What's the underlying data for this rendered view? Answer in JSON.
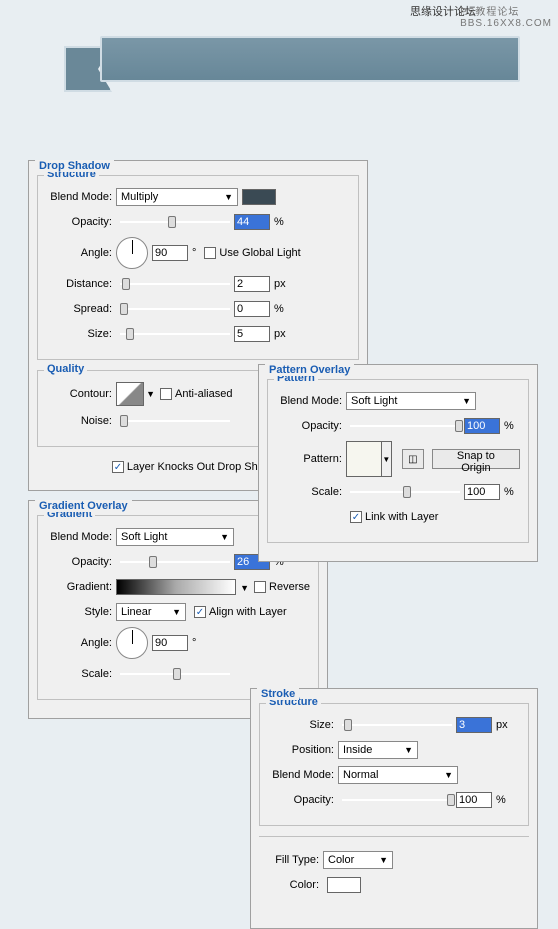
{
  "watermark": {
    "chinese": "思缘设计论坛",
    "url": "BBS.16XX8.COM",
    "sub": "PS教程论坛"
  },
  "drop_shadow": {
    "title": "Drop Shadow",
    "structure_label": "Structure",
    "blend_mode_label": "Blend Mode:",
    "blend_mode_value": "Multiply",
    "swatch_color": "#3a4a54",
    "opacity_label": "Opacity:",
    "opacity_value": "44",
    "opacity_unit": "%",
    "angle_label": "Angle:",
    "angle_value": "90",
    "angle_unit": "°",
    "use_global_label": "Use Global Light",
    "use_global_checked": false,
    "distance_label": "Distance:",
    "distance_value": "2",
    "distance_unit": "px",
    "spread_label": "Spread:",
    "spread_value": "0",
    "spread_unit": "%",
    "size_label": "Size:",
    "size_value": "5",
    "size_unit": "px",
    "quality_label": "Quality",
    "contour_label": "Contour:",
    "antialias_label": "Anti-aliased",
    "antialias_checked": false,
    "noise_label": "Noise:",
    "knockout_label": "Layer Knocks Out Drop Shadow",
    "knockout_checked": true
  },
  "pattern_overlay": {
    "title": "Pattern Overlay",
    "pattern_group": "Pattern",
    "blend_mode_label": "Blend Mode:",
    "blend_mode_value": "Soft Light",
    "opacity_label": "Opacity:",
    "opacity_value": "100",
    "opacity_unit": "%",
    "pattern_label": "Pattern:",
    "newdoc_icon": "new-doc-icon",
    "snap_label": "Snap to Origin",
    "scale_label": "Scale:",
    "scale_value": "100",
    "scale_unit": "%",
    "link_label": "Link with Layer",
    "link_checked": true
  },
  "gradient_overlay": {
    "title": "Gradient Overlay",
    "gradient_group": "Gradient",
    "blend_mode_label": "Blend Mode:",
    "blend_mode_value": "Soft Light",
    "opacity_label": "Opacity:",
    "opacity_value": "26",
    "opacity_unit": "%",
    "gradient_label": "Gradient:",
    "reverse_label": "Reverse",
    "reverse_checked": false,
    "style_label": "Style:",
    "style_value": "Linear",
    "align_label": "Align with Layer",
    "align_checked": true,
    "angle_label": "Angle:",
    "angle_value": "90",
    "angle_unit": "°",
    "scale_label": "Scale:"
  },
  "stroke": {
    "title": "Stroke",
    "structure_label": "Structure",
    "size_label": "Size:",
    "size_value": "3",
    "size_unit": "px",
    "position_label": "Position:",
    "position_value": "Inside",
    "blend_mode_label": "Blend Mode:",
    "blend_mode_value": "Normal",
    "opacity_label": "Opacity:",
    "opacity_value": "100",
    "opacity_unit": "%",
    "filltype_label": "Fill Type:",
    "filltype_value": "Color",
    "color_label": "Color:",
    "color_value": "#ffffff"
  }
}
